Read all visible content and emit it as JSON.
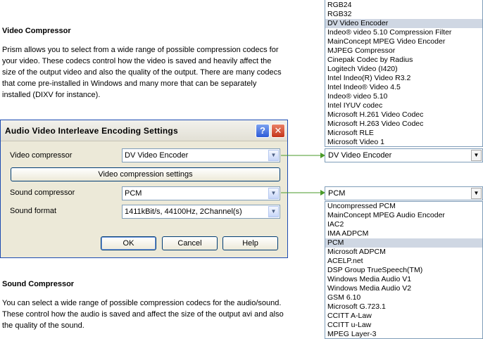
{
  "doc": {
    "video_heading": "Video Compressor",
    "video_paragraph": "Prism allows you to select from a wide range of possible compression codecs for your video. These codecs control how the video is saved and heavily affect the size of the output video and also the quality of the output. There are many codecs that come pre-installed in Windows and many more that can be separately installed (DIXV for instance).",
    "sound_heading": "Sound Compressor",
    "sound_paragraph": "You can select a wide range of possible compression codecs for the audio/sound. These control how the audio is saved and affect the size of the output avi and also the quality of the sound."
  },
  "dialog": {
    "title": "Audio Video Interleave Encoding Settings",
    "help_glyph": "?",
    "close_glyph": "✕",
    "video_compressor_label": "Video compressor",
    "video_compressor_value": "DV Video Encoder",
    "video_settings_button": "Video compression settings",
    "sound_compressor_label": "Sound compressor",
    "sound_compressor_value": "PCM",
    "sound_format_label": "Sound format",
    "sound_format_value": "1411kBit/s, 44100Hz, 2Channel(s)",
    "ok": "OK",
    "cancel": "Cancel",
    "help": "Help"
  },
  "video_list": {
    "items": [
      "RGB24",
      "RGB32",
      "DV Video Encoder",
      "Indeo® video 5.10 Compression Filter",
      "MainConcept MPEG Video Encoder",
      "MJPEG Compressor",
      "Cinepak Codec by Radius",
      "Logitech Video (I420)",
      "Intel Indeo(R) Video R3.2",
      "Intel Indeo® Video 4.5",
      "Indeo® video 5.10",
      "Intel IYUV codec",
      "Microsoft H.261 Video Codec",
      "Microsoft H.263 Video Codec",
      "Microsoft RLE",
      "Microsoft Video 1"
    ],
    "selected": "DV Video Encoder",
    "combo_value": "DV Video Encoder"
  },
  "audio_list": {
    "combo_value": "PCM",
    "items": [
      "Uncompressed PCM",
      "MainConcept MPEG Audio Encoder",
      "IAC2",
      "IMA ADPCM",
      "PCM",
      "Microsoft ADPCM",
      "ACELP.net",
      "DSP Group TrueSpeech(TM)",
      "Windows Media Audio V1",
      "Windows Media Audio V2",
      "GSM 6.10",
      "Microsoft G.723.1",
      "CCITT A-Law",
      "CCITT u-Law",
      "MPEG Layer-3"
    ],
    "selected": "PCM"
  },
  "colors": {
    "arrow": "#4a9a2a",
    "selection": "#cfd7e3",
    "dialog_border": "#1c4bb1"
  }
}
